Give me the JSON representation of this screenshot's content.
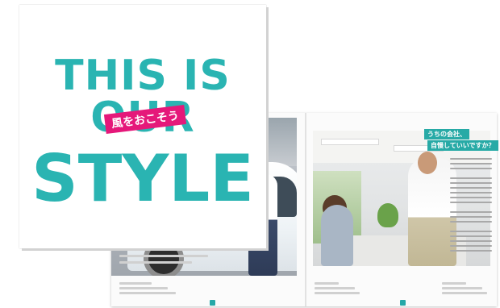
{
  "cover": {
    "line1": "THIS IS",
    "line2": "OUR",
    "line3": "STYLE",
    "sticker": "風をおこそう"
  },
  "spread": {
    "tag_line1": "うちの会社、",
    "tag_line2": "自慢していいですか？"
  },
  "colors": {
    "accent": "#2ab4b2",
    "sticker": "#e5187a"
  }
}
